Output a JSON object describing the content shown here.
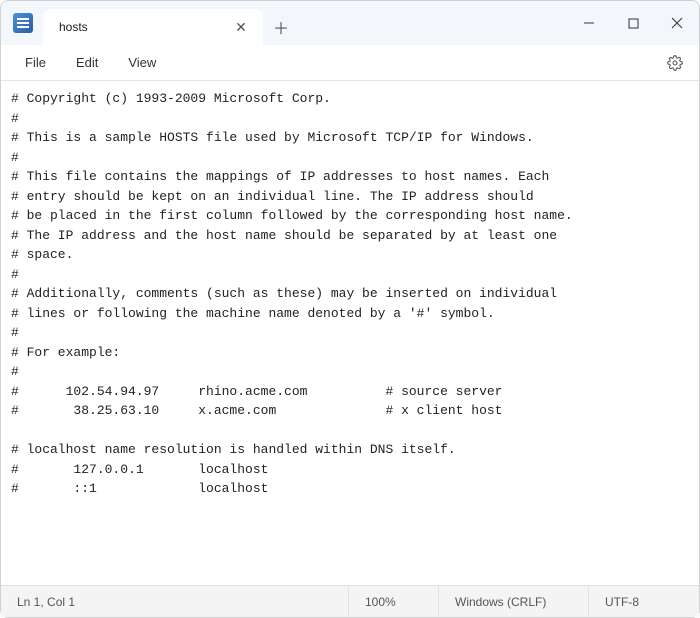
{
  "tab": {
    "title": "hosts"
  },
  "menu": {
    "file": "File",
    "edit": "Edit",
    "view": "View"
  },
  "editor": {
    "content": "# Copyright (c) 1993-2009 Microsoft Corp.\n#\n# This is a sample HOSTS file used by Microsoft TCP/IP for Windows.\n#\n# This file contains the mappings of IP addresses to host names. Each\n# entry should be kept on an individual line. The IP address should\n# be placed in the first column followed by the corresponding host name.\n# The IP address and the host name should be separated by at least one\n# space.\n#\n# Additionally, comments (such as these) may be inserted on individual\n# lines or following the machine name denoted by a '#' symbol.\n#\n# For example:\n#\n#      102.54.94.97     rhino.acme.com          # source server\n#       38.25.63.10     x.acme.com              # x client host\n\n# localhost name resolution is handled within DNS itself.\n#       127.0.0.1       localhost\n#       ::1             localhost"
  },
  "status": {
    "position": "Ln 1, Col 1",
    "zoom": "100%",
    "line_ending": "Windows (CRLF)",
    "encoding": "UTF-8"
  }
}
